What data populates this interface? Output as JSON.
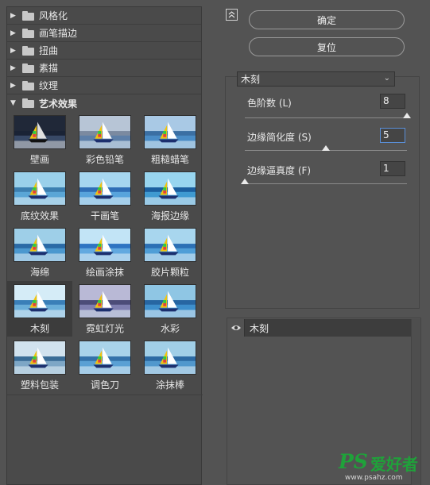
{
  "categories": [
    {
      "label": "风格化",
      "expanded": false
    },
    {
      "label": "画笔描边",
      "expanded": false
    },
    {
      "label": "扭曲",
      "expanded": false
    },
    {
      "label": "素描",
      "expanded": false
    },
    {
      "label": "纹理",
      "expanded": false
    },
    {
      "label": "艺术效果",
      "expanded": true
    }
  ],
  "filters": [
    {
      "name": "壁画",
      "selected": false
    },
    {
      "name": "彩色铅笔",
      "selected": false
    },
    {
      "name": "粗糙蜡笔",
      "selected": false
    },
    {
      "name": "底纹效果",
      "selected": false
    },
    {
      "name": "干画笔",
      "selected": false
    },
    {
      "name": "海报边缘",
      "selected": false
    },
    {
      "name": "海绵",
      "selected": false
    },
    {
      "name": "绘画涂抹",
      "selected": false
    },
    {
      "name": "胶片颗粒",
      "selected": false
    },
    {
      "name": "木刻",
      "selected": true
    },
    {
      "name": "霓虹灯光",
      "selected": false
    },
    {
      "name": "水彩",
      "selected": false
    },
    {
      "name": "塑料包装",
      "selected": false
    },
    {
      "name": "调色刀",
      "selected": false
    },
    {
      "name": "涂抹棒",
      "selected": false
    }
  ],
  "buttons": {
    "ok": "确定",
    "reset": "复位"
  },
  "filter_select": {
    "value": "木刻"
  },
  "params": [
    {
      "label": "色阶数 (L)",
      "value": "8",
      "level": 1.0
    },
    {
      "label": "边缘简化度 (S)",
      "value": "5",
      "level": 0.5
    },
    {
      "label": "边缘逼真度 (F)",
      "value": "1",
      "level": 0.0
    }
  ],
  "effect_layers": [
    {
      "name": "木刻",
      "visible": true
    }
  ],
  "watermark": {
    "logo": "PS",
    "text": "爱好者",
    "url": "www.psahz.com"
  },
  "colors": {
    "accent": "#5a8fd8",
    "watermark": "#1fa23a",
    "panel": "#535353"
  },
  "icons": {
    "collapse": "collapse-icon",
    "eye": "eye-icon",
    "folder": "folder-icon",
    "dropdown": "chevron-down-icon"
  }
}
